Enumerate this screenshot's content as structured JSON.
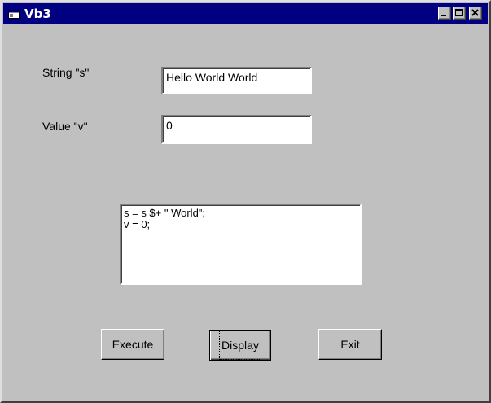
{
  "window": {
    "title": "Vb3",
    "controls": {
      "minimize_icon": "minimize-icon",
      "maximize_icon": "maximize-icon",
      "close_icon": "close-icon"
    }
  },
  "form": {
    "string_label": "String \"s\"",
    "string_value": "Hello World World",
    "value_label": "Value \"v\"",
    "value_value": "0",
    "code_lines": [
      "s = s $+ \" World\";",
      "v = 0;"
    ]
  },
  "buttons": {
    "execute_label": "Execute",
    "display_label": "Display",
    "exit_label": "Exit"
  },
  "colors": {
    "titlebar": "#000080",
    "face": "#c0c0c0",
    "field": "#ffffff"
  }
}
